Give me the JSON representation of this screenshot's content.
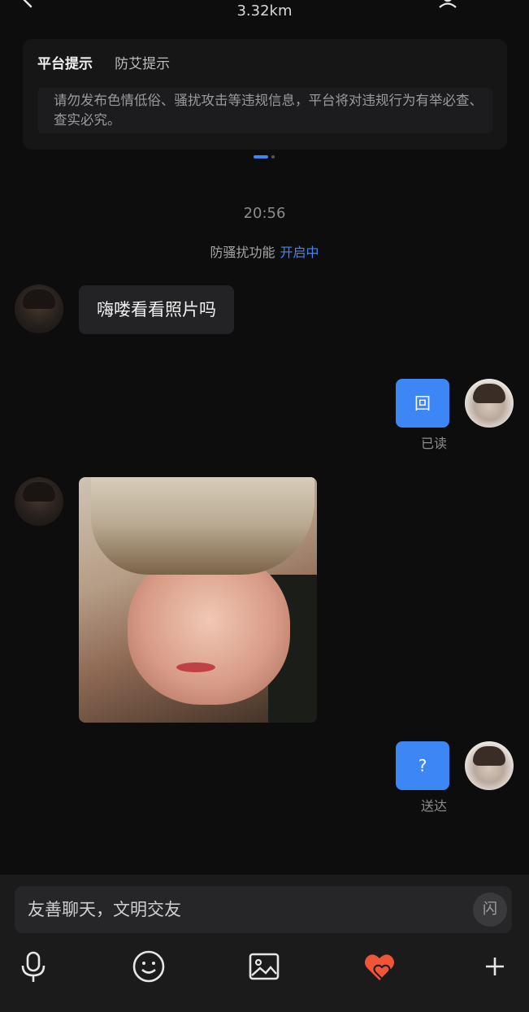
{
  "header": {
    "distance": "3.32km"
  },
  "notice": {
    "tabs": [
      "平台提示",
      "防艾提示"
    ],
    "body": "请勿发布色情低俗、骚扰攻击等违规信息，平台将对违规行为有举必查、查实必究。"
  },
  "chat": {
    "timestamp": "20:56",
    "harass_label": "防骚扰功能",
    "harass_status": "开启中",
    "messages": [
      {
        "side": "left",
        "type": "text",
        "text": "嗨喽看看照片吗"
      },
      {
        "side": "right",
        "type": "text",
        "text": "回",
        "status": "已读"
      },
      {
        "side": "left",
        "type": "image"
      },
      {
        "side": "right",
        "type": "text",
        "text": "?",
        "status": "送达"
      }
    ]
  },
  "input": {
    "placeholder": "友善聊天，文明交友",
    "flash_label": "闪"
  },
  "toolbar": [
    "microphone-icon",
    "emoji-icon",
    "image-icon",
    "heart-icon",
    "plus-icon"
  ],
  "colors": {
    "accent": "#3d86f5",
    "heart": "#f0553a",
    "background": "#0d0d0e"
  }
}
